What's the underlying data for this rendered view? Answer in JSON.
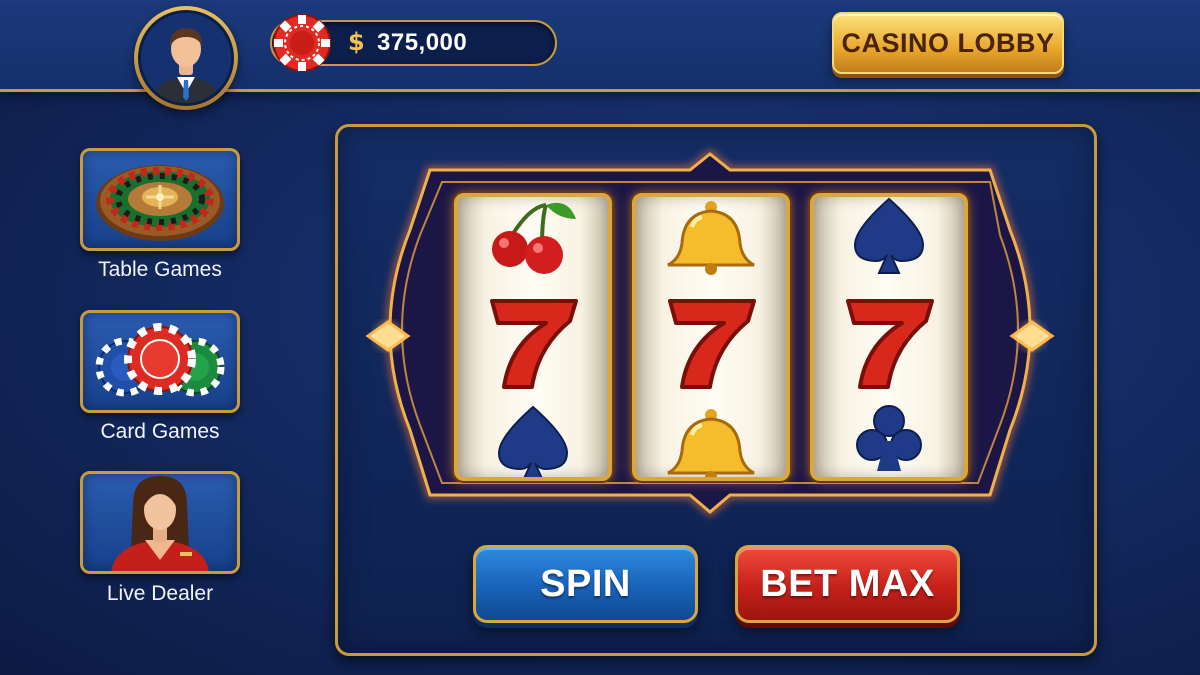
{
  "header": {
    "balance_currency_symbol": "$",
    "balance_value": "375,000",
    "lobby_button_label": "CASINO LOBBY"
  },
  "sidebar": {
    "items": [
      {
        "label": "Table Games",
        "icon": "roulette-wheel-icon"
      },
      {
        "label": "Card Games",
        "icon": "poker-chips-icon"
      },
      {
        "label": "Live Dealer",
        "icon": "dealer-avatar-icon"
      }
    ]
  },
  "slot_machine": {
    "reels": [
      {
        "symbols": [
          "cherry",
          "seven",
          "spade"
        ]
      },
      {
        "symbols": [
          "bell",
          "seven",
          "bell"
        ]
      },
      {
        "symbols": [
          "spade",
          "seven",
          "club"
        ]
      }
    ],
    "spin_label": "SPIN",
    "bet_max_label": "BET MAX"
  },
  "colors": {
    "gold_border": "#c99a3e",
    "background": "#142a62",
    "spin_blue": "#1862b8",
    "bet_red": "#c5211a",
    "seven_red": "#d8281c"
  }
}
